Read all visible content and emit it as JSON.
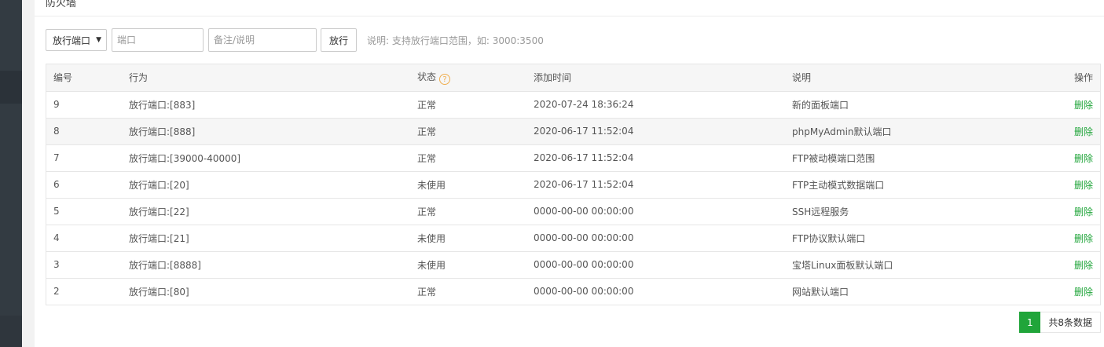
{
  "panel": {
    "title": "防火墙"
  },
  "toolbar": {
    "action_select": "放行端口",
    "port_placeholder": "端口",
    "note_placeholder": "备注/说明",
    "allow_button": "放行",
    "hint": "说明: 支持放行端口范围，如: 3000:3500"
  },
  "table": {
    "headers": [
      "编号",
      "行为",
      "状态",
      "添加时间",
      "说明",
      "操作"
    ],
    "rows": [
      {
        "id": "9",
        "action": "放行端口:[883]",
        "status": "正常",
        "time": "2020-07-24 18:36:24",
        "note": "新的面板端口",
        "op": "删除"
      },
      {
        "id": "8",
        "action": "放行端口:[888]",
        "status": "正常",
        "time": "2020-06-17 11:52:04",
        "note": "phpMyAdmin默认端口",
        "op": "删除"
      },
      {
        "id": "7",
        "action": "放行端口:[39000-40000]",
        "status": "正常",
        "time": "2020-06-17 11:52:04",
        "note": "FTP被动模端口范围",
        "op": "删除"
      },
      {
        "id": "6",
        "action": "放行端口:[20]",
        "status": "未使用",
        "time": "2020-06-17 11:52:04",
        "note": "FTP主动模式数据端口",
        "op": "删除"
      },
      {
        "id": "5",
        "action": "放行端口:[22]",
        "status": "正常",
        "time": "0000-00-00 00:00:00",
        "note": "SSH远程服务",
        "op": "删除"
      },
      {
        "id": "4",
        "action": "放行端口:[21]",
        "status": "未使用",
        "time": "0000-00-00 00:00:00",
        "note": "FTP协议默认端口",
        "op": "删除"
      },
      {
        "id": "3",
        "action": "放行端口:[8888]",
        "status": "未使用",
        "time": "0000-00-00 00:00:00",
        "note": "宝塔Linux面板默认端口",
        "op": "删除"
      },
      {
        "id": "2",
        "action": "放行端口:[80]",
        "status": "正常",
        "time": "0000-00-00 00:00:00",
        "note": "网站默认端口",
        "op": "删除"
      }
    ]
  },
  "pager": {
    "current": "1",
    "total": "共8条数据"
  },
  "colors": {
    "accent": "#20a53a",
    "help": "#f0ad4e"
  }
}
